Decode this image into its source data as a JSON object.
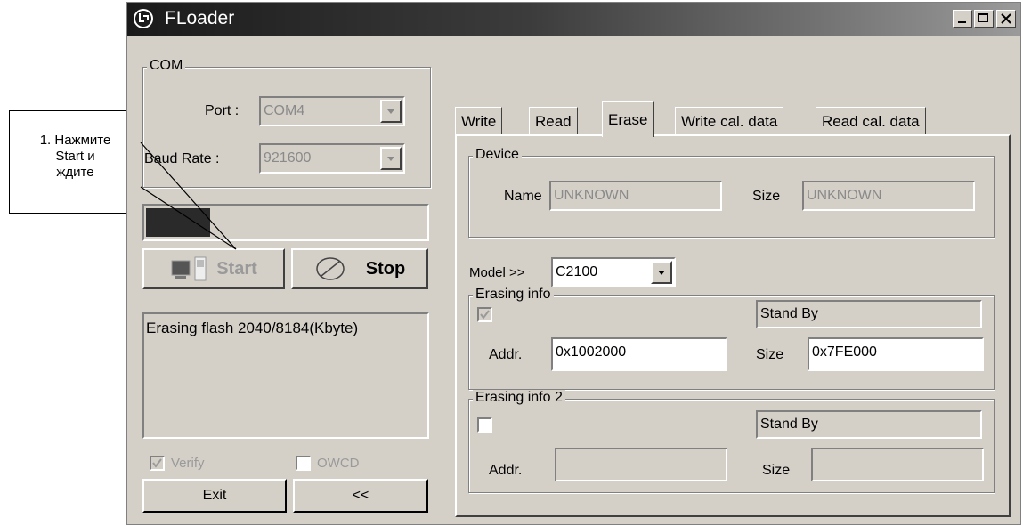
{
  "window": {
    "title": "FLoader"
  },
  "com": {
    "group_label": "COM",
    "port_label": "Port :",
    "port_value": "COM4",
    "baud_label": "Baud Rate :",
    "baud_value": "921600"
  },
  "progress": {
    "fill_fraction": 0.23
  },
  "buttons": {
    "start": "Start",
    "stop": "Stop",
    "exit": "Exit",
    "back": "<<"
  },
  "log": {
    "text": "Erasing flash 2040/8184(Kbyte)"
  },
  "options": {
    "verify_label": "Verify",
    "verify_checked": true,
    "owcd_label": "OWCD",
    "owcd_checked": false
  },
  "tabs": [
    {
      "label": "Write"
    },
    {
      "label": "Read"
    },
    {
      "label": "Erase",
      "active": true
    },
    {
      "label": "Write cal. data"
    },
    {
      "label": "Read cal. data"
    }
  ],
  "device": {
    "group_label": "Device",
    "name_label": "Name",
    "name_value": "UNKNOWN",
    "size_label": "Size",
    "size_value": "UNKNOWN"
  },
  "model": {
    "label": "Model >>",
    "value": "C2100"
  },
  "erasing1": {
    "group_label": "Erasing info",
    "checked": true,
    "status": "Stand By",
    "addr_label": "Addr.",
    "addr_value": "0x1002000",
    "size_label": "Size",
    "size_value": "0x7FE000"
  },
  "erasing2": {
    "group_label": "Erasing info 2",
    "checked": false,
    "status": "Stand By",
    "addr_label": "Addr.",
    "addr_value": "",
    "size_label": "Size",
    "size_value": ""
  },
  "callout": {
    "line1": "1. Нажмите",
    "line2": "Start и",
    "line3": "ждите"
  },
  "icons": {
    "app": "lg-logo-icon",
    "phone": "phone-pc-icon",
    "stop": "stop-circle-icon"
  },
  "colors": {
    "titlebar": "#1a1a1a",
    "face": "#d4d0c8",
    "progress": "#2a2a2a"
  }
}
